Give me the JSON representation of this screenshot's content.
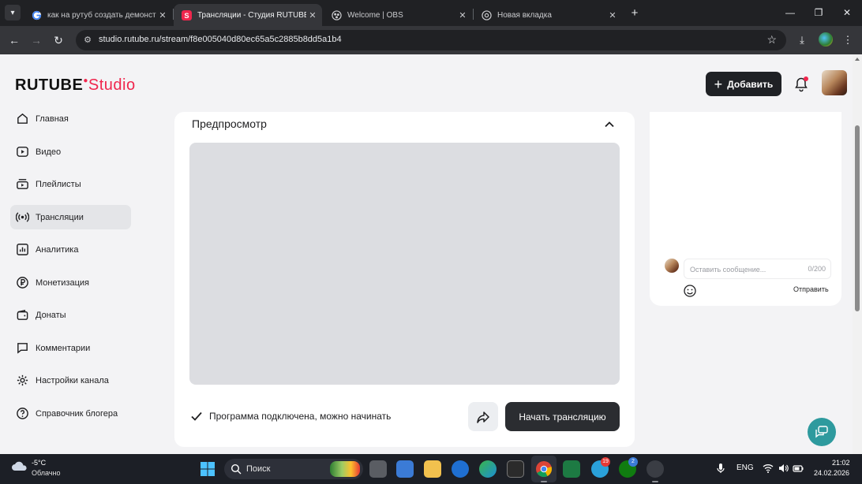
{
  "browser": {
    "tabs": [
      {
        "title": "как на рутуб создать демонстр",
        "favicon": "google-icon",
        "active": false
      },
      {
        "title": "Трансляции - Студия RUTUBE",
        "favicon": "rutube-studio-icon",
        "active": true
      },
      {
        "title": "Welcome | OBS",
        "favicon": "obs-icon",
        "active": false
      },
      {
        "title": "Новая вкладка",
        "favicon": "chrome-icon",
        "active": false
      }
    ],
    "url": "studio.rutube.ru/stream/f8e005040d80ec65a5c2885b8dd5a1b4"
  },
  "header": {
    "logo_main": "RUTUBE",
    "logo_accent": "Studio",
    "add_button": "Добавить"
  },
  "sidebar": {
    "items": [
      {
        "label": "Главная",
        "icon": "home-icon",
        "active": false
      },
      {
        "label": "Видео",
        "icon": "video-icon",
        "active": false
      },
      {
        "label": "Плейлисты",
        "icon": "playlist-icon",
        "active": false
      },
      {
        "label": "Трансляции",
        "icon": "broadcast-icon",
        "active": true
      },
      {
        "label": "Аналитика",
        "icon": "analytics-icon",
        "active": false
      },
      {
        "label": "Монетизация",
        "icon": "ruble-icon",
        "active": false
      },
      {
        "label": "Донаты",
        "icon": "wallet-icon",
        "active": false
      },
      {
        "label": "Комментарии",
        "icon": "comments-icon",
        "active": false
      },
      {
        "label": "Настройки канала",
        "icon": "gear-icon",
        "active": false
      },
      {
        "label": "Справочник блогера",
        "icon": "help-icon",
        "active": false
      }
    ]
  },
  "preview": {
    "title": "Предпросмотр",
    "status": "Программа подключена, можно начинать",
    "start_button": "Начать трансляцию"
  },
  "chat": {
    "placeholder": "Оставить сообщение...",
    "counter": "0/200",
    "send_button": "Отправить"
  },
  "taskbar": {
    "weather_temp": "-5°C",
    "weather_desc": "Облачно",
    "search_label": "Поиск",
    "language": "ENG",
    "time": "21:02",
    "date": "24.02.2026",
    "badges": {
      "telegram": "19",
      "xbox": "2"
    }
  },
  "colors": {
    "accent": "#f0264d",
    "dark_button": "#2b2d31",
    "support": "#2e9a9e"
  }
}
